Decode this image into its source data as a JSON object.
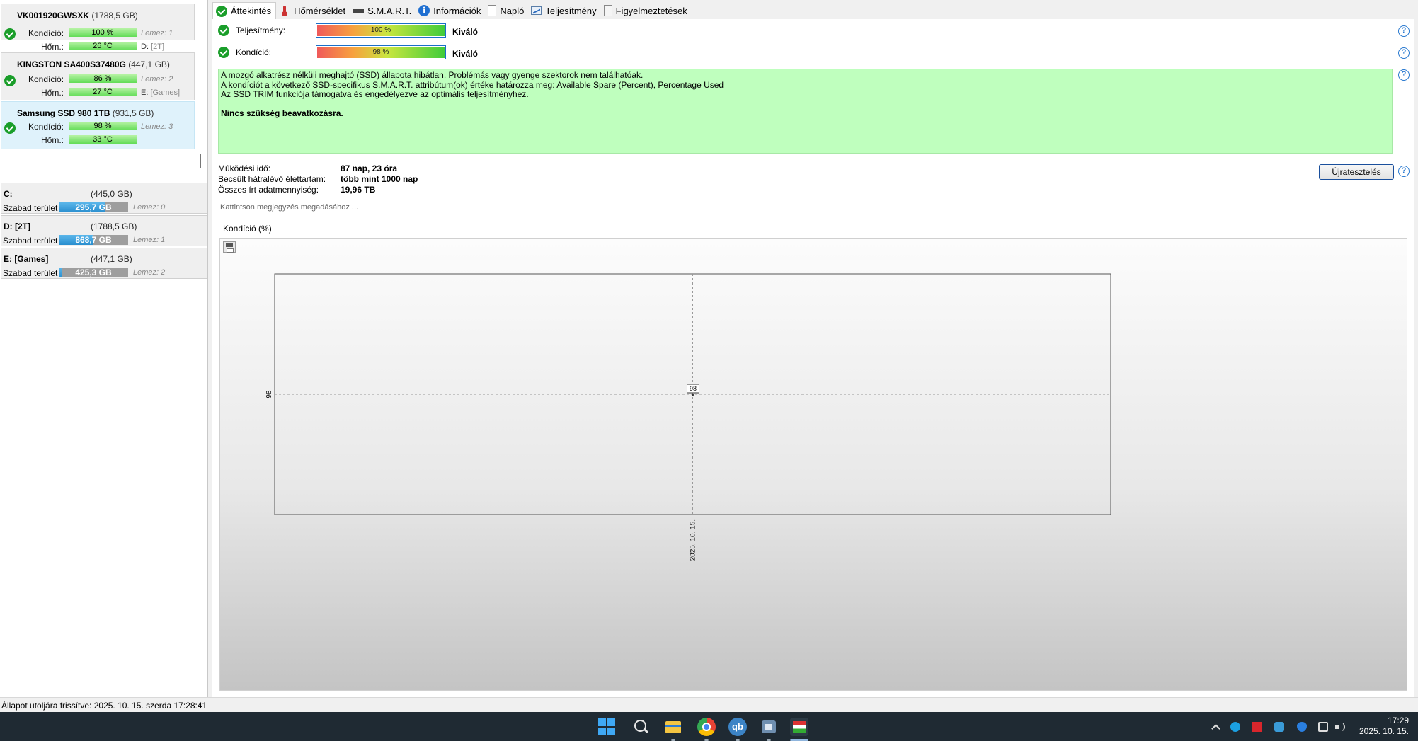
{
  "disks": [
    {
      "model": "VK001920GWSXK",
      "size": "(1788,5 GB)",
      "kond_label": "Kondíció:",
      "kond": "100 %",
      "temp_label": "Hőm.:",
      "temp": "26 °C",
      "lemez": "Lemez: 1",
      "letter": "D:",
      "letter_name": "[2T]"
    },
    {
      "model": "KINGSTON SA400S37480G",
      "size": "(447,1 GB)",
      "kond_label": "Kondíció:",
      "kond": "86 %",
      "temp_label": "Hőm.:",
      "temp": "27 °C",
      "lemez": "Lemez: 2",
      "letter": "E:",
      "letter_name": "[Games]"
    },
    {
      "model": "Samsung SSD 980 1TB",
      "size": "(931,5 GB)",
      "kond_label": "Kondíció:",
      "kond": "98 %",
      "temp_label": "Hőm.:",
      "temp": "33 °C",
      "lemez": "Lemez: 3"
    }
  ],
  "volumes": [
    {
      "name": "C:",
      "size": "(445,0 GB)",
      "free_label": "Szabad terület",
      "free": "295,7 GB",
      "free_fraction": 0.66,
      "lemez": "Lemez: 0"
    },
    {
      "name": "D: [2T]",
      "size": "(1788,5 GB)",
      "free_label": "Szabad terület",
      "free": "868,7 GB",
      "free_fraction": 0.49,
      "lemez": "Lemez: 1"
    },
    {
      "name": "E: [Games]",
      "size": "(447,1 GB)",
      "free_label": "Szabad terület",
      "free": "425,3 GB",
      "free_fraction": 0.05,
      "lemez": "Lemez: 2"
    }
  ],
  "tabs": [
    {
      "label": "Áttekintés",
      "icon": "check-icon"
    },
    {
      "label": "Hőmérséklet",
      "icon": "thermometer-icon"
    },
    {
      "label": "S.M.A.R.T.",
      "icon": "smart-icon"
    },
    {
      "label": "Információk",
      "icon": "info-icon"
    },
    {
      "label": "Napló",
      "icon": "document-icon"
    },
    {
      "label": "Teljesítmény",
      "icon": "chart-icon"
    },
    {
      "label": "Figyelmeztetések",
      "icon": "warnings-icon"
    }
  ],
  "status": {
    "perf_label": "Teljesítmény:",
    "perf_value": "100 %",
    "perf_verdict": "Kiváló",
    "health_label": "Kondíció:",
    "health_value": "98 %",
    "health_verdict": "Kiváló"
  },
  "description": {
    "line1": "A mozgó alkatrész nélküli meghajtó (SSD) állapota hibátlan. Problémás vagy gyenge szektorok nem találhatóak.",
    "line2": "A kondíciót a következő SSD-specifikus S.M.A.R.T. attribútum(ok) értéke határozza meg:  Available Spare (Percent), Percentage Used",
    "line3": "Az SSD TRIM funkciója támogatva és engedélyezve az optimális teljesítményhez.",
    "bold": "Nincs szükség beavatkozásra."
  },
  "details": [
    {
      "label": "Működési idő:",
      "value": "87 nap, 23 óra"
    },
    {
      "label": "Becsült hátralévő élettartam:",
      "value": "több mint 1000 nap"
    },
    {
      "label": "Összes írt adatmennyiség:",
      "value": "19,96 TB"
    }
  ],
  "retest_label": "Újratesztelés",
  "note_placeholder": "Kattintson megjegyzés megadásához ...",
  "chart_title": "Kondíció  (%)",
  "chart_data": {
    "type": "line",
    "x": [
      "2025. 10. 15."
    ],
    "series": [
      {
        "values": [
          98
        ]
      }
    ],
    "point_labels": [
      "98"
    ],
    "y_ticks": [
      "98"
    ],
    "grid": true
  },
  "statusbar": "Állapot utoljára frissítve: 2025. 10. 15. szerda 17:28:41",
  "clock": {
    "time": "17:29",
    "date": "2025. 10. 15."
  }
}
